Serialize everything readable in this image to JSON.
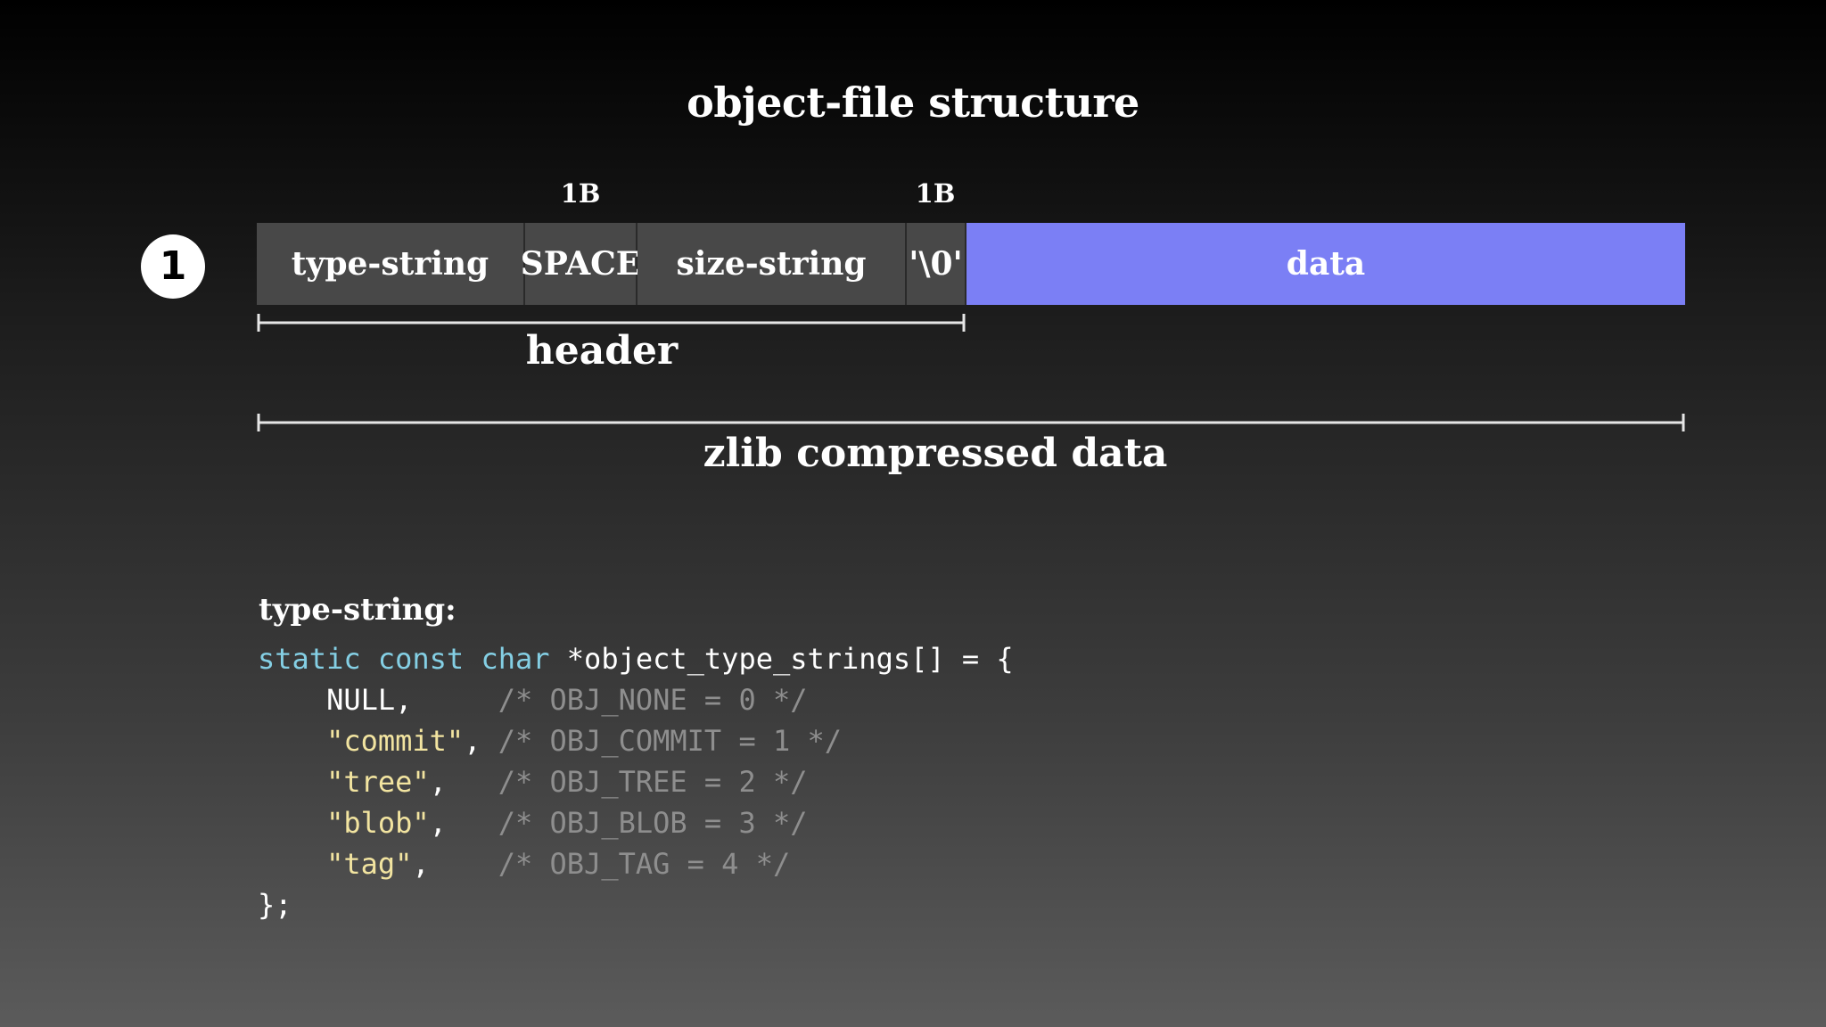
{
  "diagram": {
    "title": "object-file structure",
    "step_number": "1",
    "size_labels": [
      "1B",
      "1B"
    ],
    "segments": [
      {
        "label": "type-string"
      },
      {
        "label": "SPACE"
      },
      {
        "label": "size-string"
      },
      {
        "label": "'\\0'"
      },
      {
        "label": "data"
      }
    ],
    "header_label": "header",
    "compressed_label": "zlib compressed data",
    "colors": {
      "segment": "#484848",
      "data_segment": "#7b7ff5",
      "keyword": "#84cfe4",
      "string": "#f2e4a0",
      "comment": "#8e8e8e"
    }
  },
  "code": {
    "heading": "type-string:",
    "line1": {
      "kw1": "static",
      "kw2": "const",
      "kw3": "char",
      "rest": "*object_type_strings[] = {"
    },
    "entries": [
      {
        "value": "NULL",
        "comment": "/* OBJ_NONE = 0 */"
      },
      {
        "value": "\"commit\"",
        "comment": "/* OBJ_COMMIT = 1 */"
      },
      {
        "value": "\"tree\"",
        "comment": "/* OBJ_TREE = 2 */"
      },
      {
        "value": "\"blob\"",
        "comment": "/* OBJ_BLOB = 3 */"
      },
      {
        "value": "\"tag\"",
        "comment": "/* OBJ_TAG = 4 */"
      }
    ],
    "closing": "};"
  }
}
